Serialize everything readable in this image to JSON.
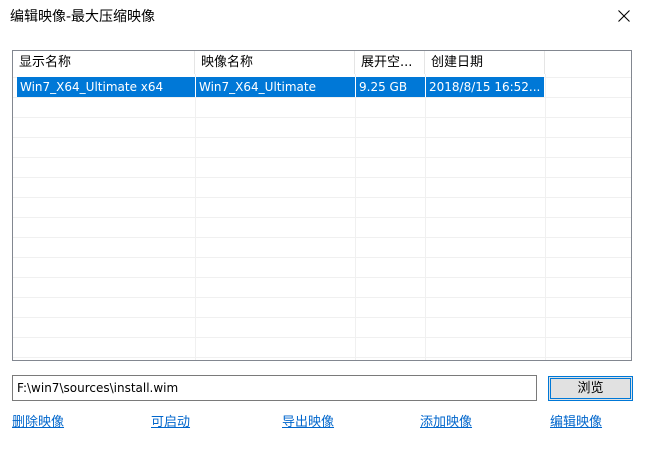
{
  "window": {
    "title": "编辑映像-最大压缩映像",
    "close_icon": "close-icon"
  },
  "list": {
    "columns": [
      "显示名称",
      "映像名称",
      "展开空...",
      "创建日期"
    ],
    "rows": [
      {
        "display_name": "Win7_X64_Ultimate x64",
        "image_name": "Win7_X64_Ultimate",
        "size": "9.25 GB",
        "created": "2018/8/15 16:52...",
        "selected": true
      }
    ]
  },
  "path": {
    "value": "F:\\win7\\sources\\install.wim"
  },
  "buttons": {
    "browse": "浏览"
  },
  "links": {
    "delete": "删除映像",
    "bootable": "可启动",
    "export": "导出映像",
    "add": "添加映像",
    "edit": "编辑映像"
  },
  "colors": {
    "selection": "#0078d7",
    "link": "#0066cc",
    "accent_border": "#0078d7"
  }
}
